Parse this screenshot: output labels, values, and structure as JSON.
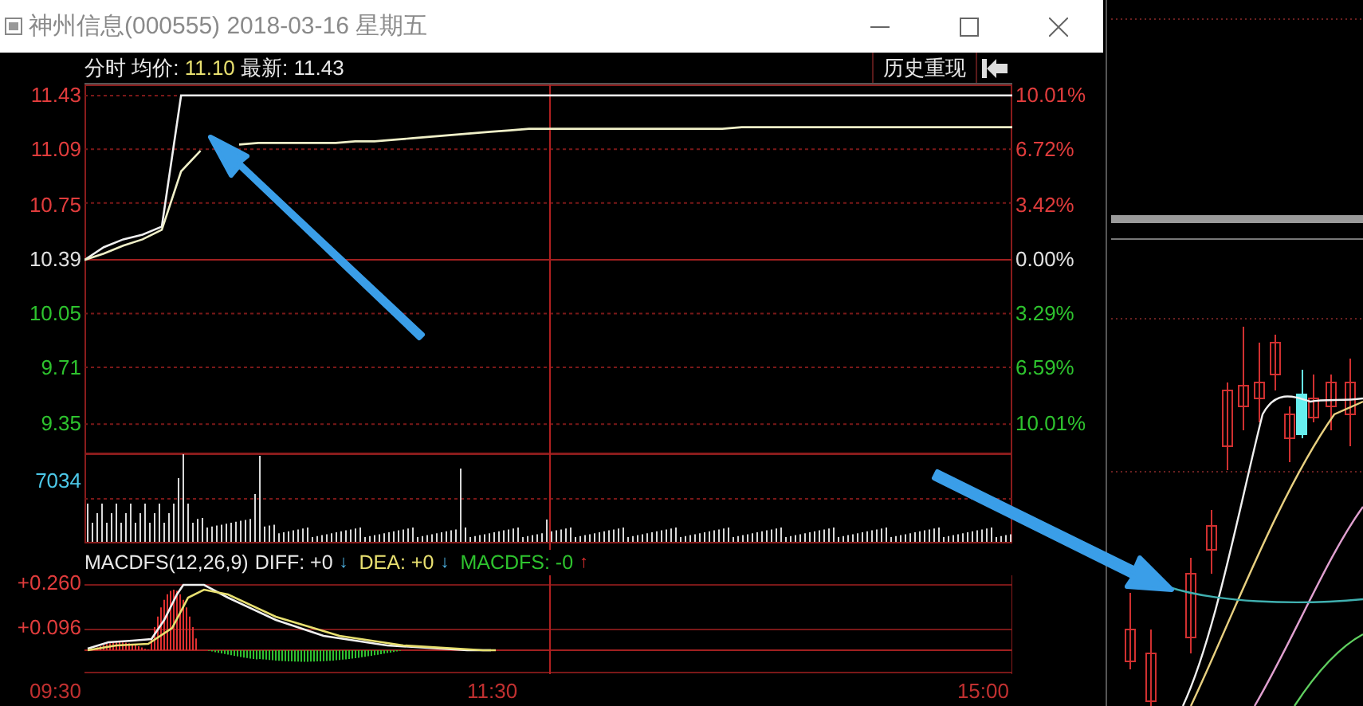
{
  "window": {
    "title": "神州信息(000555) 2018-03-16 星期五"
  },
  "header": {
    "mode": "分时",
    "avg_label": "均价:",
    "avg_value": "11.10",
    "latest_label": "最新:",
    "latest_value": "11.43",
    "history_button": "历史重现"
  },
  "percent_axis": [
    {
      "label": "10.01%",
      "kind": "up"
    },
    {
      "label": "6.72%",
      "kind": "up"
    },
    {
      "label": "3.42%",
      "kind": "up"
    },
    {
      "label": "0.00%",
      "kind": "flat"
    },
    {
      "label": "3.29%",
      "kind": "down"
    },
    {
      "label": "6.59%",
      "kind": "down"
    },
    {
      "label": "10.01%",
      "kind": "down"
    }
  ],
  "price_chart": {
    "chart_data": {
      "type": "line",
      "grid": true,
      "ref_lines": [
        {
          "axis": "y",
          "value": 10.39
        }
      ],
      "ylim": [
        9.16,
        11.5
      ],
      "yticks": [
        9.35,
        9.71,
        10.05,
        10.39,
        10.75,
        11.09,
        11.43
      ],
      "series": [
        {
          "color": "#f0f0f0",
          "values": [
            10.39,
            10.47,
            10.52,
            10.55,
            10.6,
            11.43,
            11.43,
            11.43,
            11.43,
            11.43,
            11.43,
            11.43,
            11.43,
            11.43,
            11.43,
            11.43,
            11.43,
            11.43,
            11.43,
            11.43,
            11.43,
            11.43,
            11.43,
            11.43,
            11.43,
            11.43,
            11.43,
            11.43,
            11.43,
            11.43,
            11.43,
            11.43,
            11.43,
            11.43,
            11.43,
            11.43,
            11.43,
            11.43,
            11.43,
            11.43,
            11.43,
            11.43,
            11.43,
            11.43,
            11.43,
            11.43,
            11.43,
            11.43,
            11.43
          ]
        },
        {
          "color": "#f0f0c8",
          "values": [
            10.39,
            10.43,
            10.48,
            10.52,
            10.58,
            10.95,
            11.08,
            null,
            11.12,
            11.13,
            11.13,
            11.13,
            11.13,
            11.13,
            11.14,
            11.14,
            11.15,
            11.16,
            11.17,
            11.18,
            11.19,
            11.2,
            11.21,
            11.22,
            11.22,
            11.22,
            11.22,
            11.22,
            11.22,
            11.22,
            11.22,
            11.22,
            11.22,
            11.22,
            11.23,
            11.23,
            11.23,
            11.23,
            11.23,
            11.23,
            11.23,
            11.23,
            11.23,
            11.23,
            11.23,
            11.23,
            11.23,
            11.23,
            11.23
          ]
        }
      ]
    }
  },
  "volume_axis": "7034",
  "macd": {
    "name": "MACDFS(12,26,9)",
    "diff": "DIFF: +0",
    "diff_arrow": "↓",
    "dea": "DEA: +0",
    "dea_arrow": "↓",
    "macdfs": "MACDFS: -0",
    "macdfs_arrow": "↑"
  },
  "macd_axis": [
    "+0.260",
    "+0.096"
  ],
  "time_axis": [
    "09:30",
    "11:30",
    "15:00"
  ]
}
